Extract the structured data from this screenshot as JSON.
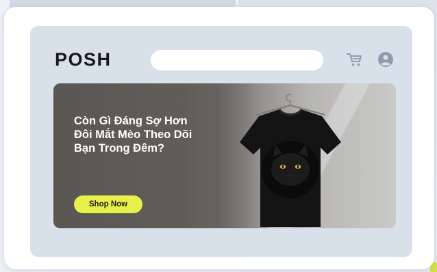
{
  "store": {
    "logo": "POSH"
  },
  "header": {
    "search": {
      "value": "",
      "placeholder": ""
    },
    "icons": [
      "cart-icon",
      "account-icon"
    ]
  },
  "hero": {
    "headline_lines": [
      "Còn Gì Đáng Sợ Hơn",
      "Đôi Mắt Mèo Theo Dõi",
      "Bạn Trong Đêm?"
    ],
    "cta_label": "Shop Now",
    "product_image": "black t-shirt with black cat face print on hanger"
  },
  "colors": {
    "page_background": "#e3e8ee",
    "card_background": "#ffffff",
    "frame_background": "#d8e0e9",
    "cta_accent": "#e8f04c",
    "header_icons": "#8f9aab",
    "logo_text": "#17181a"
  }
}
